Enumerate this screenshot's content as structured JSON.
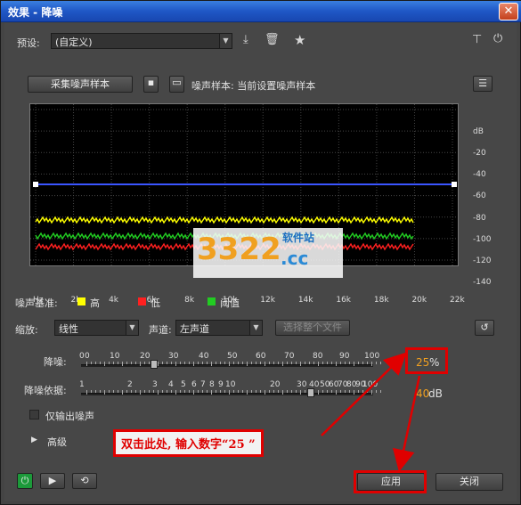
{
  "window": {
    "title": "效果 - 降噪",
    "close_icon": "close-icon"
  },
  "preset": {
    "label": "预设:",
    "value": "(自定义)"
  },
  "toolbar": {
    "save_icon": "download-icon",
    "delete_icon": "trash-icon",
    "star_icon": "star-icon",
    "route_icon": "routing-icon",
    "power_icon": "power-icon"
  },
  "noise_print": {
    "capture_button": "采集噪声样本",
    "label": "噪声样本: 当前设置噪声样本"
  },
  "graph": {
    "y_ticks": [
      "dB",
      "-20",
      "-40",
      "-60",
      "-80",
      "-100",
      "-120",
      "-140"
    ],
    "x_ticks": [
      "Hz",
      "2k",
      "4k",
      "6k",
      "8k",
      "10k",
      "12k",
      "14k",
      "16k",
      "18k",
      "20k",
      "22k"
    ],
    "line_color": "#3a55ff"
  },
  "legend": {
    "title": "噪声基准:",
    "items": [
      {
        "label": "高",
        "color": "#ffff00"
      },
      {
        "label": "低",
        "color": "#ff2020"
      },
      {
        "label": "阈值",
        "color": "#22cc22"
      }
    ]
  },
  "controls": {
    "scale_label": "缩放:",
    "scale_value": "线性",
    "channel_label": "声道:",
    "channel_value": "左声道",
    "select_file_button": "选择整个文件"
  },
  "noise_reduction": {
    "label": "降噪:",
    "scale": [
      "0",
      "0",
      "10",
      "20",
      "30",
      "40",
      "50",
      "60",
      "70",
      "80",
      "90",
      "100"
    ],
    "value": "25",
    "unit": "%"
  },
  "reduce_by": {
    "label": "降噪依据:",
    "scale": [
      "1",
      "2",
      "3",
      "4",
      "5",
      "6",
      "7",
      "8",
      "9",
      "10",
      "20",
      "30",
      "40",
      "50",
      "60",
      "70",
      "80",
      "90",
      "100"
    ],
    "value": "40",
    "unit": "dB"
  },
  "output_noise_only": {
    "label": "仅输出噪声"
  },
  "advanced": {
    "label": "高级"
  },
  "annotation": {
    "text": "双击此处, 输入数字“25 ”"
  },
  "watermark": {
    "text": "3322.cc",
    "subtitle": "软件站"
  },
  "footer": {
    "apply": "应用",
    "close": "关闭"
  }
}
